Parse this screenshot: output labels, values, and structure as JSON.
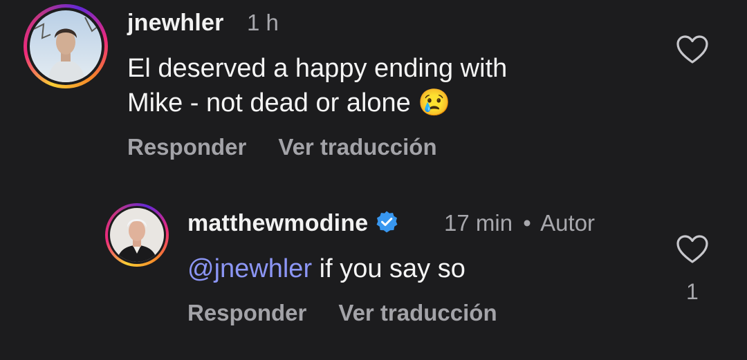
{
  "comments": [
    {
      "username": "jnewhler",
      "time": "1 h",
      "text": "El deserved a happy ending with Mike - not dead or alone 😢",
      "text_line1": "El deserved a happy ending with",
      "text_line2": "Mike - not dead or alone",
      "emoji": "😢",
      "reply_label": "Responder",
      "translate_label": "Ver traducción",
      "like_icon": "heart-outline-icon"
    },
    {
      "username": "matthewmodine",
      "verified": true,
      "time": "17 min",
      "separator": "•",
      "author_label": "Autor",
      "mention": "@jnewhler",
      "text": "if you say so",
      "reply_label": "Responder",
      "translate_label": "Ver traducción",
      "like_icon": "heart-outline-icon",
      "like_count": "1"
    }
  ],
  "colors": {
    "background": "#1c1c1e",
    "mention": "#8c96f5",
    "verified": "#3897f0",
    "secondary_text": "#a8a8ad"
  }
}
